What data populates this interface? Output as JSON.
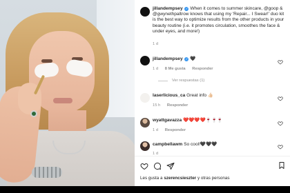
{
  "post": {
    "caption_user": "jillandempsey",
    "caption_text": "When it comes to summer skincare, @goop & @gwynethpaltrow knows that using my 'Repair... I Swear!' duo kit is the best way to optimize results from the other products in your beauty routine (i.e. it promotes circulation, smoothes the face & under eyes, and more!)",
    "caption_age": "1 d"
  },
  "comments": [
    {
      "user": "jillandempsey",
      "text": "🖤",
      "age": "1 d",
      "likes": "8 Me gusta",
      "reply": "Responder",
      "view_replies": "Ver respuestas (1)",
      "avatar_text": "jillian"
    },
    {
      "user": "laserlicious_ca",
      "text": "Great info 👍🏻",
      "age": "15 h",
      "reply": "Responder",
      "avatar_text": "laser"
    },
    {
      "user": "wyattgavazza",
      "text": "❤️❤️❤️❤️🍷🍷🍷",
      "age": "1 d",
      "reply": "Responder"
    },
    {
      "user": "campbellawm",
      "text": "So cool!🖤🖤🖤",
      "age": "1 d"
    }
  ],
  "footer": {
    "liked_by_prefix": "Les gusta a ",
    "liked_by_user": "szerencsieszter",
    "liked_by_suffix": " y otras personas"
  },
  "icons": {
    "like": "heart-icon",
    "comment": "comment-icon",
    "share": "share-icon",
    "save": "bookmark-icon"
  }
}
